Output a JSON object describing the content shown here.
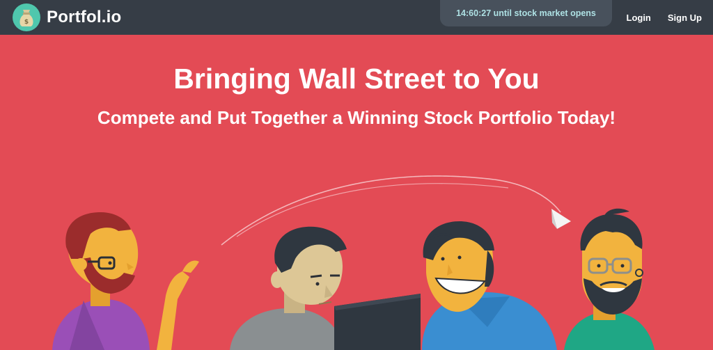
{
  "header": {
    "brand": "Portfol.io",
    "countdown": "14:60:27 until stock market opens",
    "nav": {
      "login": "Login",
      "signup": "Sign Up"
    }
  },
  "hero": {
    "title": "Bringing Wall Street to You",
    "subtitle": "Compete and Put Together a Winning Stock Portfolio Today!"
  },
  "icons": {
    "logo": "money-bag-icon",
    "illustration": "people-illustration"
  },
  "colors": {
    "hero_bg": "#e34b55",
    "topbar_bg": "#363d46",
    "accent": "#4fc7ad",
    "countdown_text": "#aee1e4"
  }
}
